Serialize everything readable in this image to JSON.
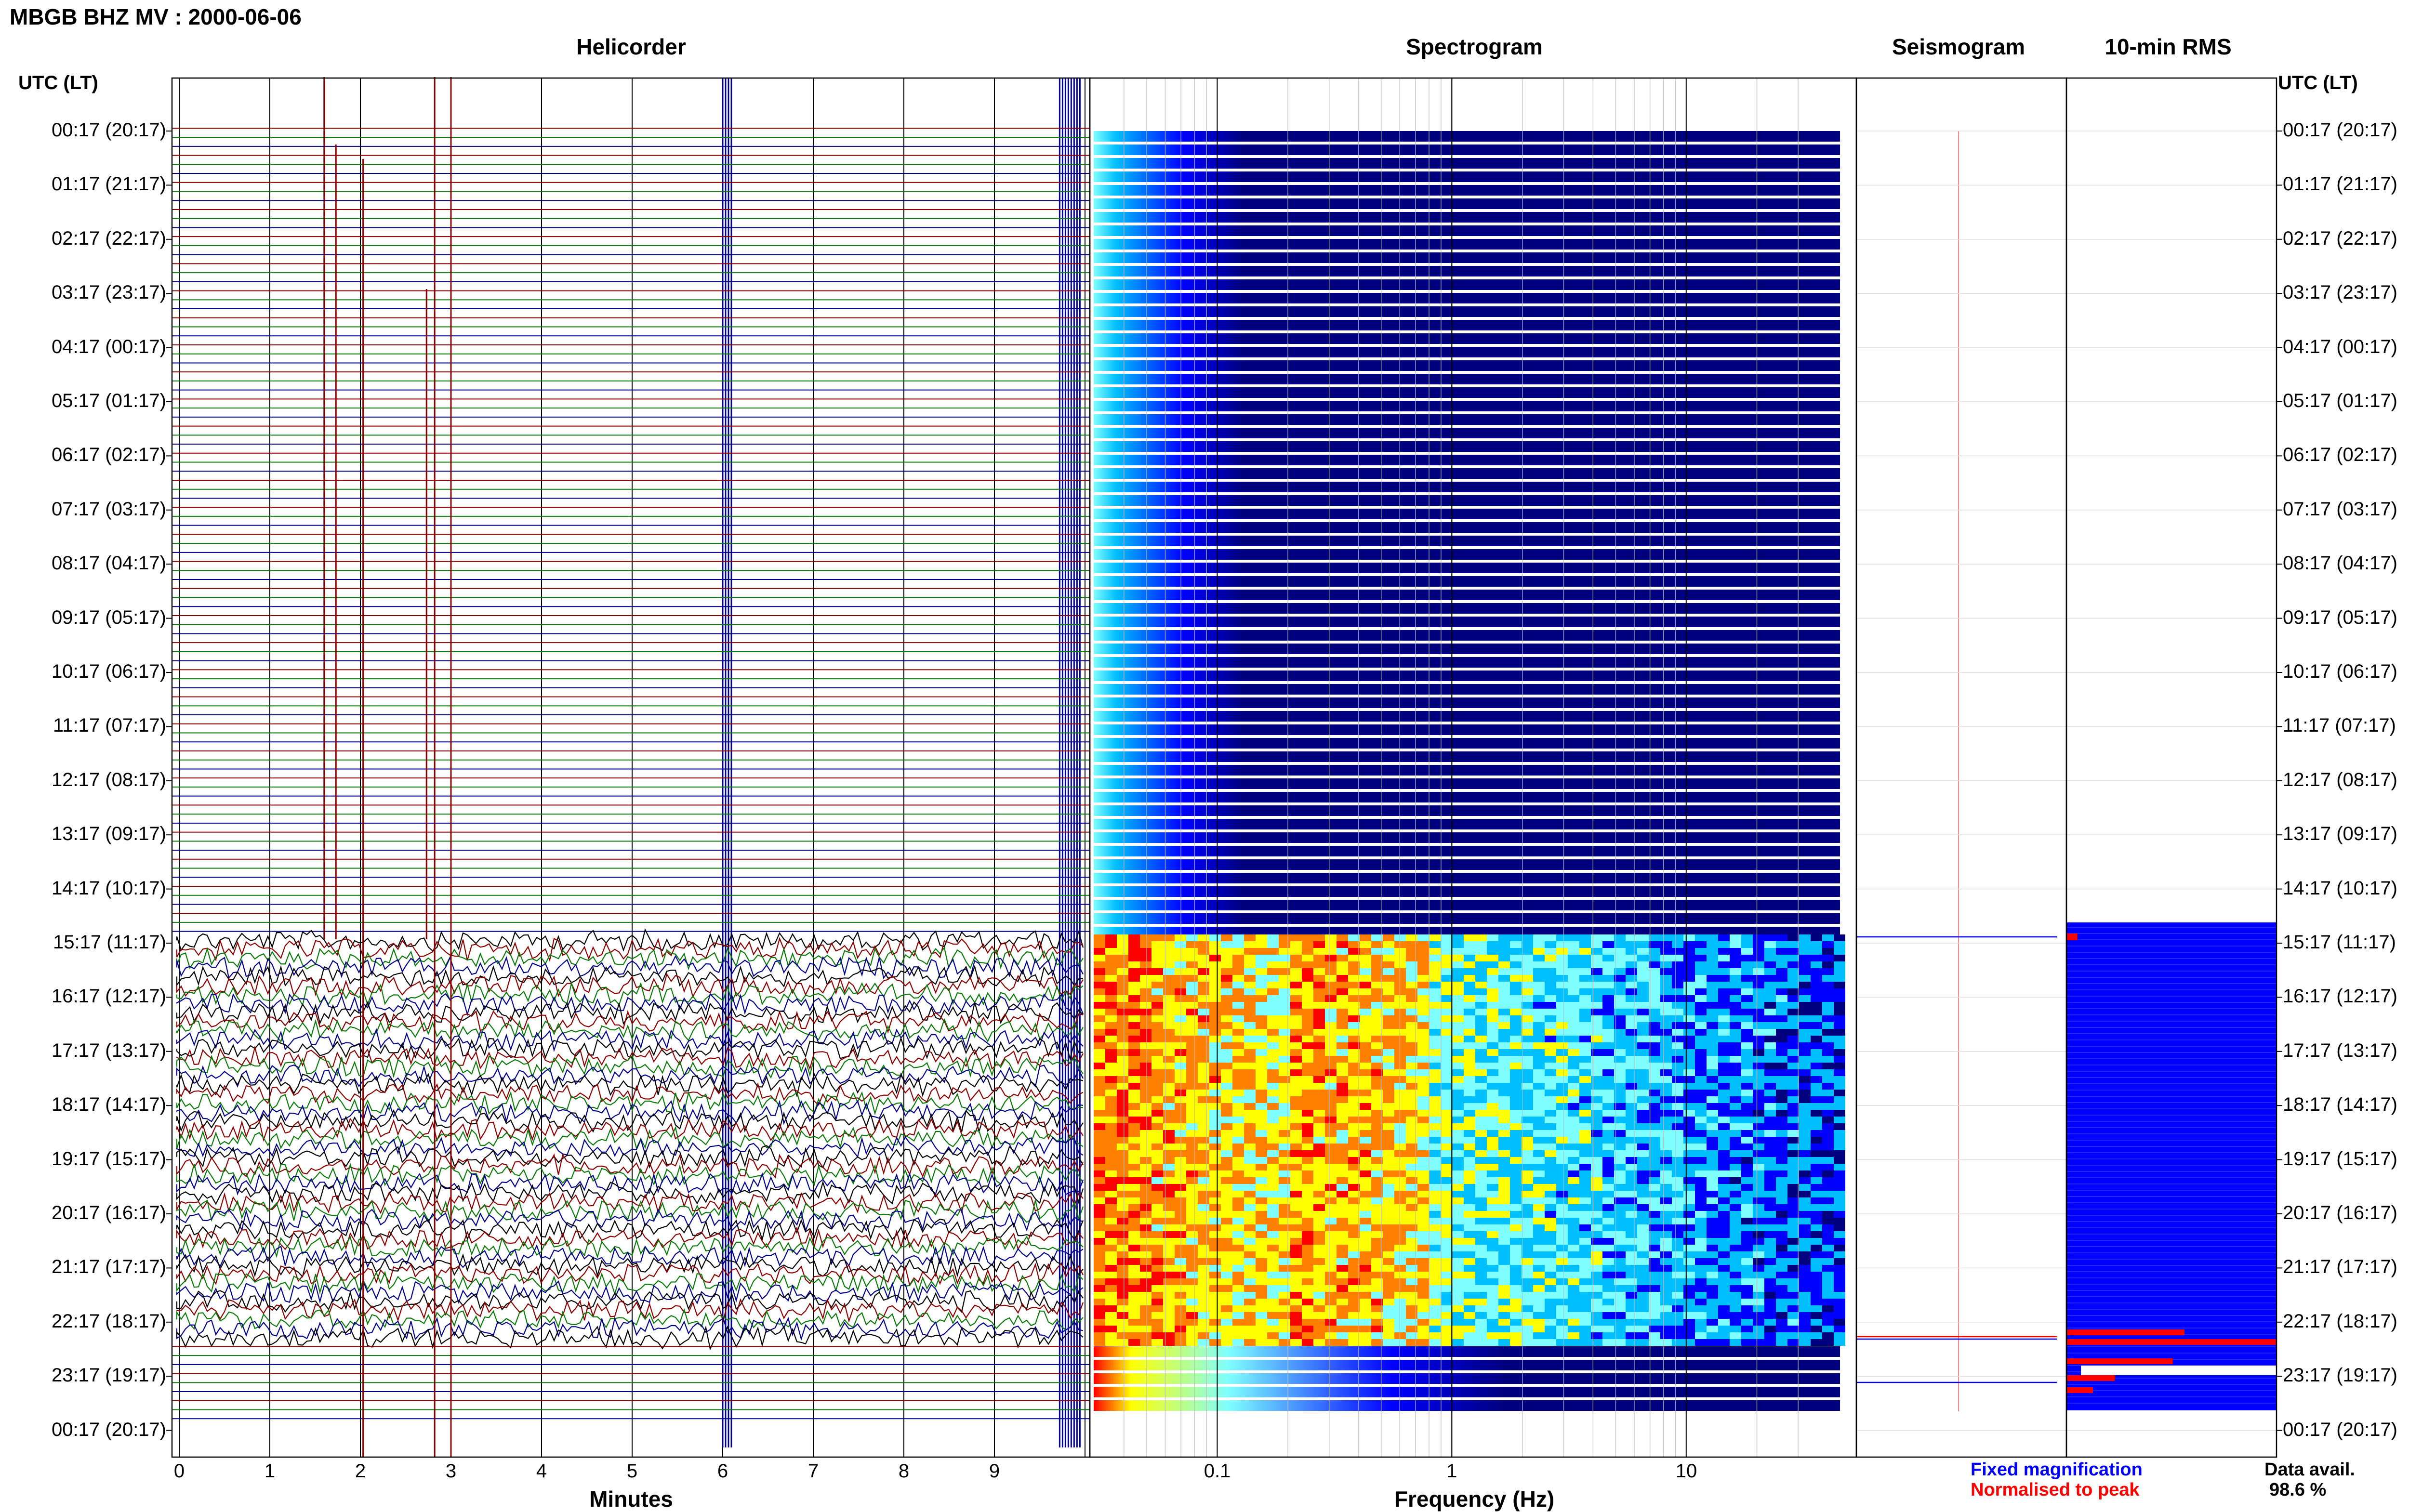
{
  "title": "MBGB BHZ MV : 2000-06-06",
  "panels": {
    "helicorder": "Helicorder",
    "spectrogram": "Spectrogram",
    "seismogram": "Seismogram",
    "rms": "10-min RMS"
  },
  "axis": {
    "left_header": "UTC (LT)",
    "right_header": "UTC (LT)",
    "helicorder_xlabel": "Minutes",
    "spectrogram_xlabel": "Frequency (Hz)"
  },
  "legend": {
    "fixed": "Fixed magnification",
    "normalised": "Normalised to peak",
    "fixed_color": "#0000ff",
    "normalised_color": "#ff0000"
  },
  "data_avail": {
    "label": "Data avail.",
    "value": "98.6 %"
  },
  "chart_data": {
    "type": "heatmap",
    "time_labels": [
      "00:17 (20:17)",
      "01:17 (21:17)",
      "02:17 (22:17)",
      "03:17 (23:17)",
      "04:17 (00:17)",
      "05:17 (01:17)",
      "06:17 (02:17)",
      "07:17 (03:17)",
      "08:17 (04:17)",
      "09:17 (05:17)",
      "10:17 (06:17)",
      "11:17 (07:17)",
      "12:17 (08:17)",
      "13:17 (09:17)",
      "14:17 (10:17)",
      "15:17 (11:17)",
      "16:17 (12:17)",
      "17:17 (13:17)",
      "18:17 (14:17)",
      "19:17 (15:17)",
      "20:17 (16:17)",
      "21:17 (17:17)",
      "22:17 (18:17)",
      "23:17 (19:17)",
      "00:17 (20:17)"
    ],
    "helicorder_x_ticks": [
      "0",
      "1",
      "2",
      "3",
      "4",
      "5",
      "6",
      "7",
      "8",
      "9"
    ],
    "helicorder_xlim": [
      0,
      10
    ],
    "spectrogram_x_ticks": [
      "0.1",
      "1",
      "10"
    ],
    "spectrogram_xlim": [
      0.03,
      40
    ],
    "spectrogram_scale": "log",
    "active_period_start": "15:17",
    "active_period_end": "22:40",
    "trace_colors": [
      "#8b0000",
      "#0a7a0a",
      "#00008b",
      "#000000"
    ],
    "colormap": [
      "#00007f",
      "#0000ff",
      "#00bfff",
      "#7fffff",
      "#ffff00",
      "#ff7f00",
      "#ff0000"
    ]
  }
}
